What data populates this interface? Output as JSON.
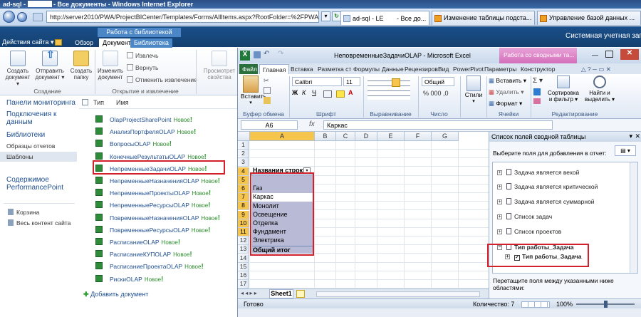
{
  "ie": {
    "title_prefix": "ad-sql - ",
    "title_suffix": " - Все документы - Windows Internet Explorer",
    "url": "http://server2010/PWA/ProjectBICenter/Templates/Forms/AllItems.aspx?RootFolder=%2FPWA%2FProjec",
    "tabs": [
      {
        "label": "ad-sql - LE",
        "suffix": " - Все до..."
      },
      {
        "label": "Изменение таблицы подста..."
      },
      {
        "label": "Управление базой данных ..."
      }
    ]
  },
  "sp": {
    "site_actions": "Действия сайта",
    "browse_tab": "Обзор",
    "group_label": "Работа с библиотекой",
    "tab_docs": "Документы",
    "tab_library": "Библиотека",
    "user": "Системная учетная запи",
    "ribbon": {
      "new_doc": [
        "Создать",
        "документ"
      ],
      "upload": [
        "Отправить",
        "документ"
      ],
      "new_folder": [
        "Создать",
        "папку"
      ],
      "edit_doc": [
        "Изменить",
        "документ"
      ],
      "checkout": "Извлечь",
      "checkin": "Вернуть",
      "discard": "Отменить извлечение",
      "view_props": [
        "Просмотрет",
        "свойства"
      ],
      "group_create": "Создание",
      "group_open": "Открытие и извлечение"
    },
    "quicklaunch": {
      "dashboards": "Панели мониторинга",
      "connections": [
        "Подключения к",
        "данным"
      ],
      "libraries": "Библиотеки",
      "samples": "Образцы отчетов",
      "templates": "Шаблоны",
      "ppcontent": [
        "Содержимое",
        "PerformancePoint"
      ],
      "recycle": "Корзина",
      "all_content": "Весь контент сайта"
    },
    "list": {
      "col_type": "Тип",
      "col_name": "Имя",
      "new_label": "Новое",
      "add_doc": "Добавить документ",
      "items": [
        "OlapProjectSharePoint",
        "АнализПортфеляOLAP",
        "ВопросыOLAP",
        "КонечныеРезультатыOLAP",
        "НепременныеЗадачиOLAP",
        "НепременныеНазначенияOLAP",
        "НепременныеПроектыOLAP",
        "НепременныеРесурсыOLAP",
        "ПовременныеНазначенияOLAP",
        "ПовременныеРесурсыOLAP",
        "РасписаниеOLAP",
        "РасписаниеКУПOLAP",
        "РасписаниеПроектаOLAP",
        "РискиOLAP"
      ]
    }
  },
  "excel": {
    "title": "НеповременныеЗадачиOLAP - Microsoft Excel",
    "pivot_context": "Работа со сводными та...",
    "tabs": [
      "Файл",
      "Главная",
      "Вставка",
      "Разметка ст",
      "Формулы",
      "Данные",
      "Рецензиров",
      "Вид",
      "PowerPivot",
      "Параметры",
      "Конструктор"
    ],
    "ribbon": {
      "paste": "Вставить",
      "font": "Calibri",
      "size": "11",
      "number_format": "Общий",
      "styles": "Стили",
      "insert": "Вставить",
      "delete": "Удалить",
      "format": "Формат",
      "sort": [
        "Сортировка",
        "и фильтр"
      ],
      "find": [
        "Найти и",
        "выделить"
      ],
      "sum": "Σ",
      "groups": [
        "Буфер обмена",
        "Шрифт",
        "Выравнивание",
        "Число",
        "Ячейки",
        "Редактирование"
      ]
    },
    "namebox": "A6",
    "formula": "Каркас",
    "columns": [
      "A",
      "B",
      "C",
      "D",
      "E",
      "F",
      "G"
    ],
    "rows": [
      "1",
      "2",
      "3",
      "4",
      "5",
      "6",
      "7",
      "8",
      "9",
      "10",
      "11",
      "12",
      "13",
      "14",
      "15",
      "16",
      "17"
    ],
    "pivot": {
      "header": "Названия строк",
      "items": [
        "",
        "Газ",
        "Каркас",
        "Монолит",
        "Освещение",
        "Отделка",
        "Фундамент",
        "Электрика"
      ],
      "total": "Общий итог"
    },
    "sheet_tab": "Sheet1",
    "status": {
      "ready": "Готово",
      "count": "Количество: 7",
      "zoom": "100%"
    },
    "pane": {
      "title": "Список полей сводной таблицы",
      "hint": "Выберите поля для добавления в отчет:",
      "fields": [
        "Задача является вехой",
        "Задача является критической",
        "Задача является суммарной",
        "Список задач",
        "Список проектов",
        "Тип работы_Задача"
      ],
      "subfield": "Тип работы_Задача",
      "drag_hint": [
        "Перетащите поля между указанными ниже",
        "областями:"
      ]
    }
  }
}
